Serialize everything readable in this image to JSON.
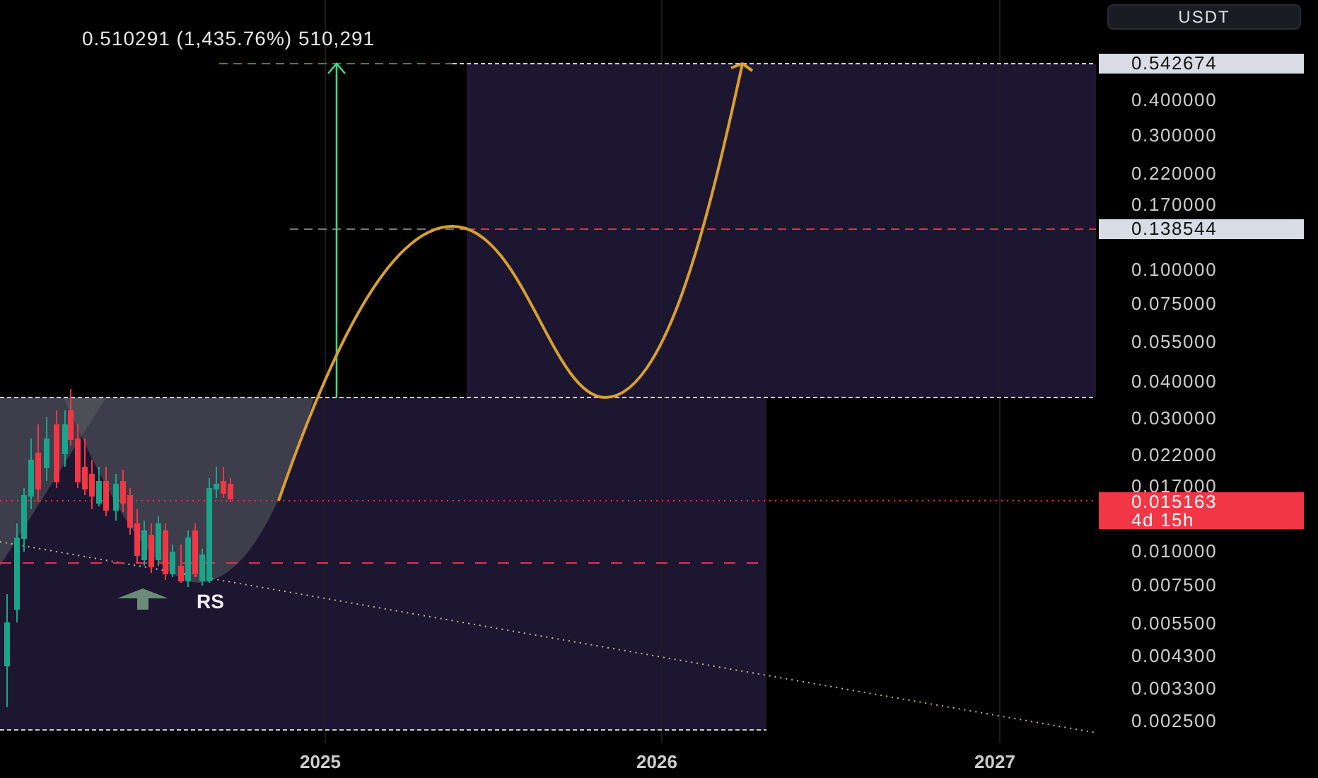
{
  "measure_label": "0.510291 (1,435.76%) 510,291",
  "currency_button": "USDT",
  "price_axis": {
    "labels": [
      "0.400000",
      "0.300000",
      "0.220000",
      "0.170000",
      "0.100000",
      "0.075000",
      "0.055000",
      "0.040000",
      "0.030000",
      "0.022000",
      "0.017000",
      "0.010000",
      "0.007500",
      "0.005500",
      "0.004300",
      "0.003300",
      "0.002500"
    ],
    "tags": [
      {
        "kind": "target",
        "text": "0.542674"
      },
      {
        "kind": "target",
        "text": "0.138544"
      },
      {
        "kind": "last",
        "text": "0.015163",
        "countdown": "4d 15h"
      }
    ]
  },
  "annotation": "RS",
  "time_axis": [
    "2025",
    "2026",
    "2027"
  ]
}
